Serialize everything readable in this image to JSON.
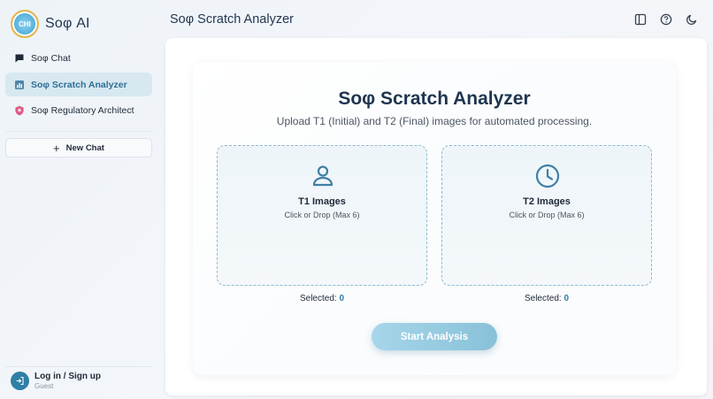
{
  "sidebar": {
    "brand": "Soφ AI",
    "logo_text": "CHI",
    "items": [
      {
        "label": "Soφ Chat",
        "icon": "chat-bubble-icon",
        "active": false
      },
      {
        "label": "Soφ Scratch Analyzer",
        "icon": "bar-chart-icon",
        "active": true
      },
      {
        "label": "Soφ Regulatory Architect",
        "icon": "shield-icon",
        "active": false
      }
    ],
    "new_chat_label": "New Chat",
    "new_chat_icon": "plus-icon",
    "login_title": "Log in / Sign up",
    "login_sub": "Guest",
    "login_icon": "login-arrow-icon"
  },
  "header": {
    "title": "Soφ Scratch Analyzer",
    "icons": [
      "sidebar-toggle-icon",
      "help-icon",
      "dark-mode-icon"
    ]
  },
  "main": {
    "title": "Soφ Scratch Analyzer",
    "subtitle": "Upload T1 (Initial) and T2 (Final) images for automated processing.",
    "dropzones": [
      {
        "title": "T1 Images",
        "hint": "Click or Drop (Max 6)",
        "icon": "user-icon",
        "selected_label": "Selected:",
        "selected_count": "0"
      },
      {
        "title": "T2 Images",
        "hint": "Click or Drop (Max 6)",
        "icon": "clock-icon",
        "selected_label": "Selected:",
        "selected_count": "0"
      }
    ],
    "start_button": "Start Analysis"
  },
  "colors": {
    "accent": "#2f7fa6",
    "active_bg": "#d7e8f1",
    "button_start": "#a6d6ea",
    "button_end": "#88c1d8"
  }
}
